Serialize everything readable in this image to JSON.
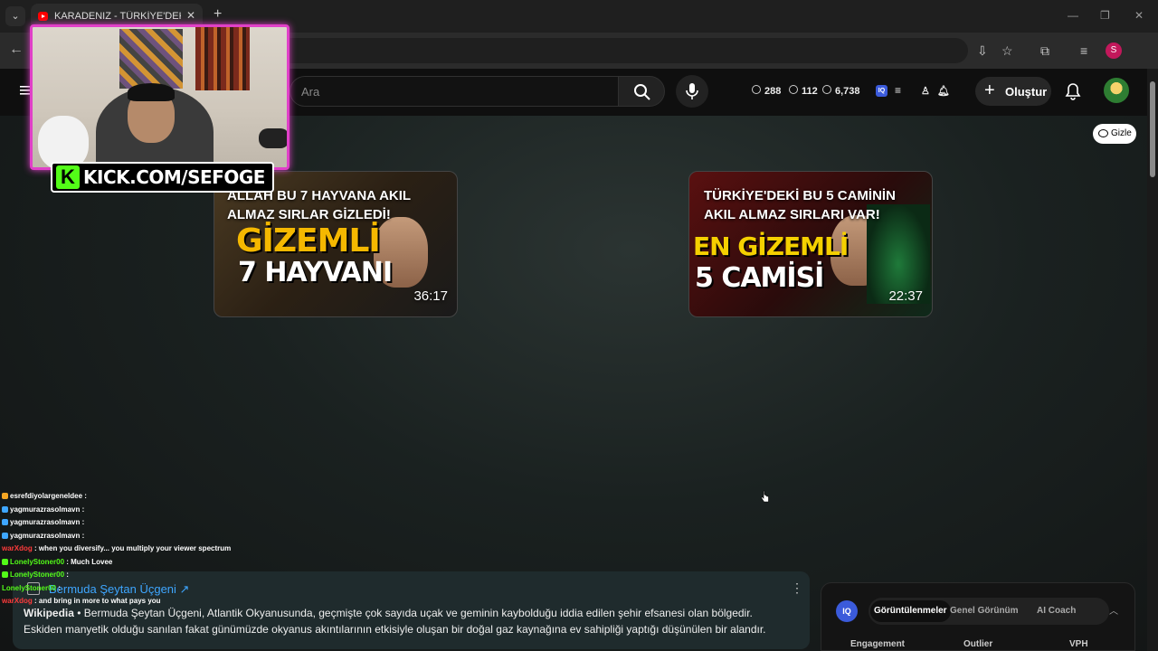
{
  "browser": {
    "tab_title": "KARADENIZ - TÜRKİYE'DEKİ BE",
    "profile_initial": "S"
  },
  "header": {
    "search_placeholder": "Ara",
    "stats": {
      "value1": "288",
      "value2": "112",
      "value3": "6,738"
    },
    "iq_label": "IQ",
    "create_label": "Oluştur"
  },
  "gizle_label": "Gizle",
  "videos": [
    {
      "overlay_title": "ALLAH BU 7 HAYVANA AKIL ALMAZ SIRLAR GİZLEDİ!",
      "thumb_line1": "GİZEMLİ",
      "thumb_line2": "7 HAYVANI",
      "duration": "36:17"
    },
    {
      "overlay_title": "TÜRKİYE'DEKİ BU 5 CAMİNİN AKIL ALMAZ SIRLARI VAR!",
      "thumb_line1": "EN GİZEMLİ",
      "thumb_line2": "5 CAMİSİ",
      "duration": "22:37"
    }
  ],
  "overlay": {
    "kick_text": "KICK.COM/SEFOGE",
    "kick_letter": "K"
  },
  "chat": [
    {
      "user": "esrefdiyolargeneldee",
      "message": "",
      "color": "#ffffff",
      "badge": "#f5a623"
    },
    {
      "user": "yagmurazrasolmavn",
      "message": "",
      "color": "#ffffff",
      "badge": "#3ea6ff"
    },
    {
      "user": "yagmurazrasolmavn",
      "message": "",
      "color": "#ffffff",
      "badge": "#3ea6ff"
    },
    {
      "user": "yagmurazrasolmavn",
      "message": "",
      "color": "#ffffff",
      "badge": "#3ea6ff"
    },
    {
      "user": "warXdog",
      "message": "when you diversify... you multiply your viewer spectrum",
      "color": "#ff3b3b",
      "badge": ""
    },
    {
      "user": "LonelyStoner00",
      "message": "Much Lovee",
      "color": "#53fc18",
      "badge": "#53fc18"
    },
    {
      "user": "LonelyStoner00",
      "message": "",
      "color": "#53fc18",
      "badge": "#53fc18"
    },
    {
      "user": "LonelyStoner00",
      "message": "",
      "color": "#53fc18",
      "badge": ""
    },
    {
      "user": "warXdog",
      "message": "and bring in more to what pays you",
      "color": "#ff3b3b",
      "badge": ""
    }
  ],
  "knowledge_panel": {
    "title": "Bermuda Şeytan Üçgeni ↗",
    "source": "Wikipedia",
    "text": " • Bermuda Şeytan Üçgeni, Atlantik Okyanusunda, geçmişte çok sayıda uçak ve geminin kaybolduğu iddia edilen şehir efsanesi olan bölgedir. Eskiden manyetik olduğu sanılan fakat günümüzde okyanus akıntılarının etkisiyle oluşan bir doğal gaz kaynağına ev sahipliği yaptığı düşünülen bir alandır."
  },
  "analytics": {
    "iq_label": "IQ",
    "tabs": [
      "Görüntülenmeler",
      "Genel Görünüm",
      "AI Coach"
    ],
    "columns": [
      "Engagement",
      "Outlier",
      "VPH"
    ]
  }
}
